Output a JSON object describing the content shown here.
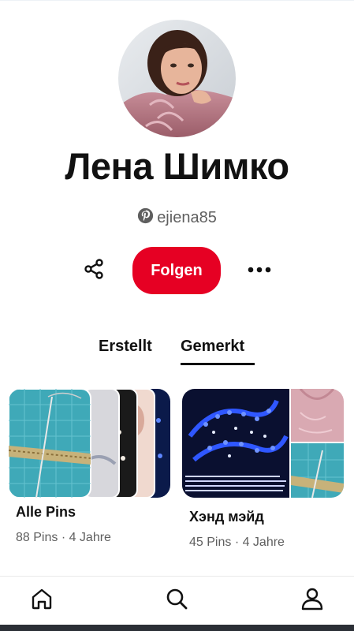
{
  "profile": {
    "name": "Лена Шимко",
    "handle": "ejiena85"
  },
  "actions": {
    "follow_label": "Folgen"
  },
  "tabs": [
    {
      "label": "Erstellt",
      "selected": false
    },
    {
      "label": "Gemerkt",
      "selected": true
    }
  ],
  "boards": [
    {
      "title": "Alle Pins",
      "meta": "88 Pins · 4 Jahre"
    },
    {
      "title": "Хэнд мэйд",
      "meta": "45 Pins · 4 Jahre"
    }
  ],
  "colors": {
    "accent": "#e60023",
    "muted_text": "#5f5f5f"
  },
  "icons": {
    "share": "share-icon",
    "more": "more-horizontal-icon",
    "brand": "pinterest-logo-icon",
    "nav": [
      "home-icon",
      "search-icon",
      "profile-icon"
    ]
  }
}
